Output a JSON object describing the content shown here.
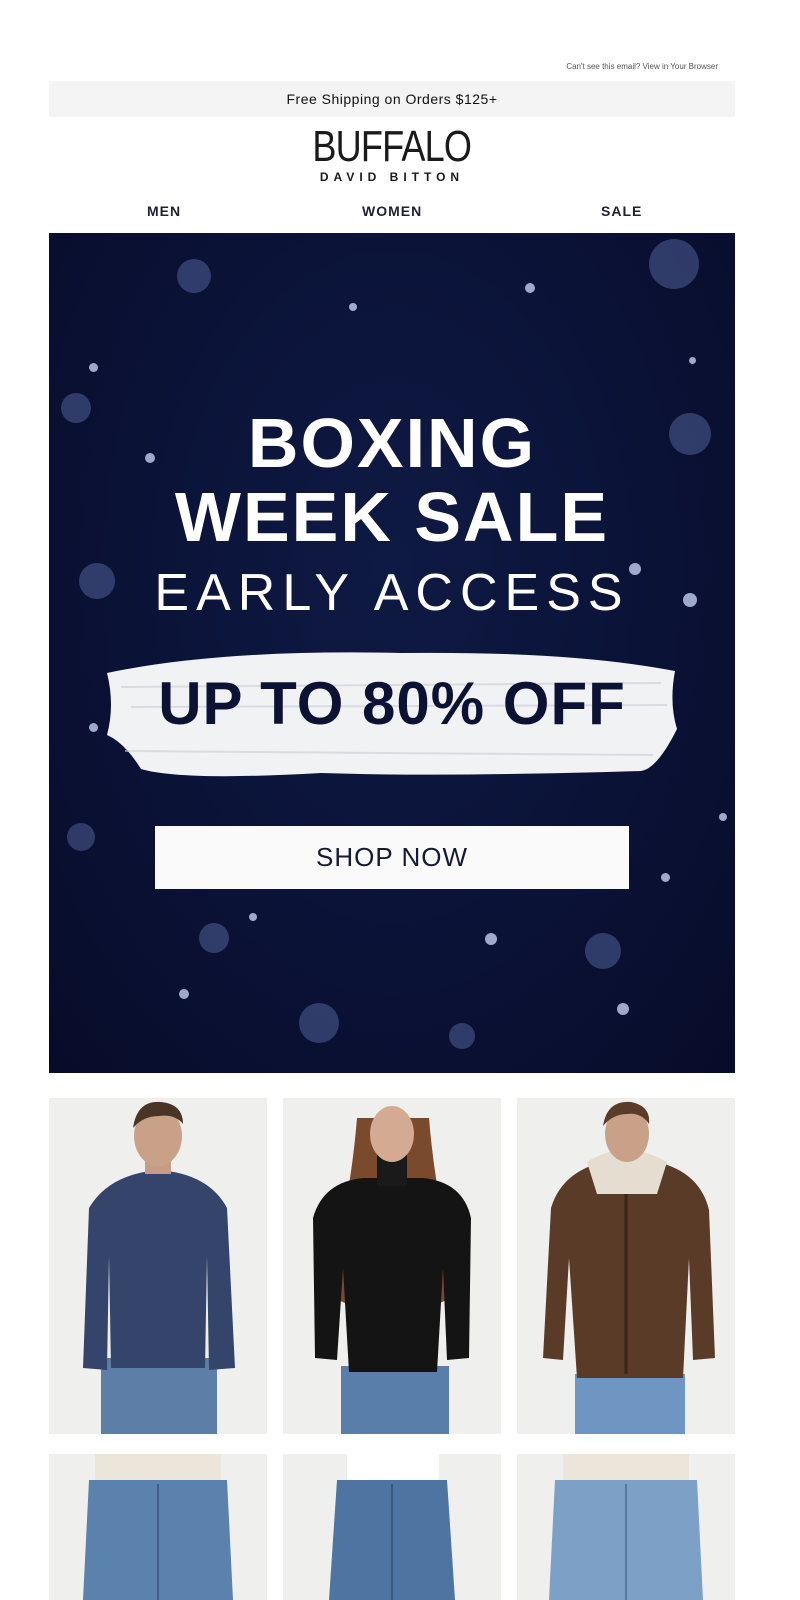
{
  "header": {
    "view_in_browser": "Can't see this email? View in Your Browser",
    "shipping_banner": "Free Shipping on Orders $125+",
    "logo_main": "BUFFALO",
    "logo_sub": "DAVID BITTON"
  },
  "nav": {
    "items": [
      {
        "label": "MEN"
      },
      {
        "label": "WOMEN"
      },
      {
        "label": "SALE"
      }
    ]
  },
  "hero": {
    "title_line1": "BOXING",
    "title_line2": "WEEK SALE",
    "subtitle": "EARLY ACCESS",
    "offer": "UP TO 80% OFF",
    "cta": "SHOP NOW",
    "background_color": "#0a1236"
  },
  "products": [
    {
      "name": "men-henley",
      "icon": "product-photo"
    },
    {
      "name": "women-turtleneck",
      "icon": "product-photo"
    },
    {
      "name": "men-hoodie",
      "icon": "product-photo"
    },
    {
      "name": "men-jeans",
      "icon": "product-photo"
    },
    {
      "name": "women-jeans",
      "icon": "product-photo"
    },
    {
      "name": "men-jeans-light",
      "icon": "product-photo"
    }
  ]
}
